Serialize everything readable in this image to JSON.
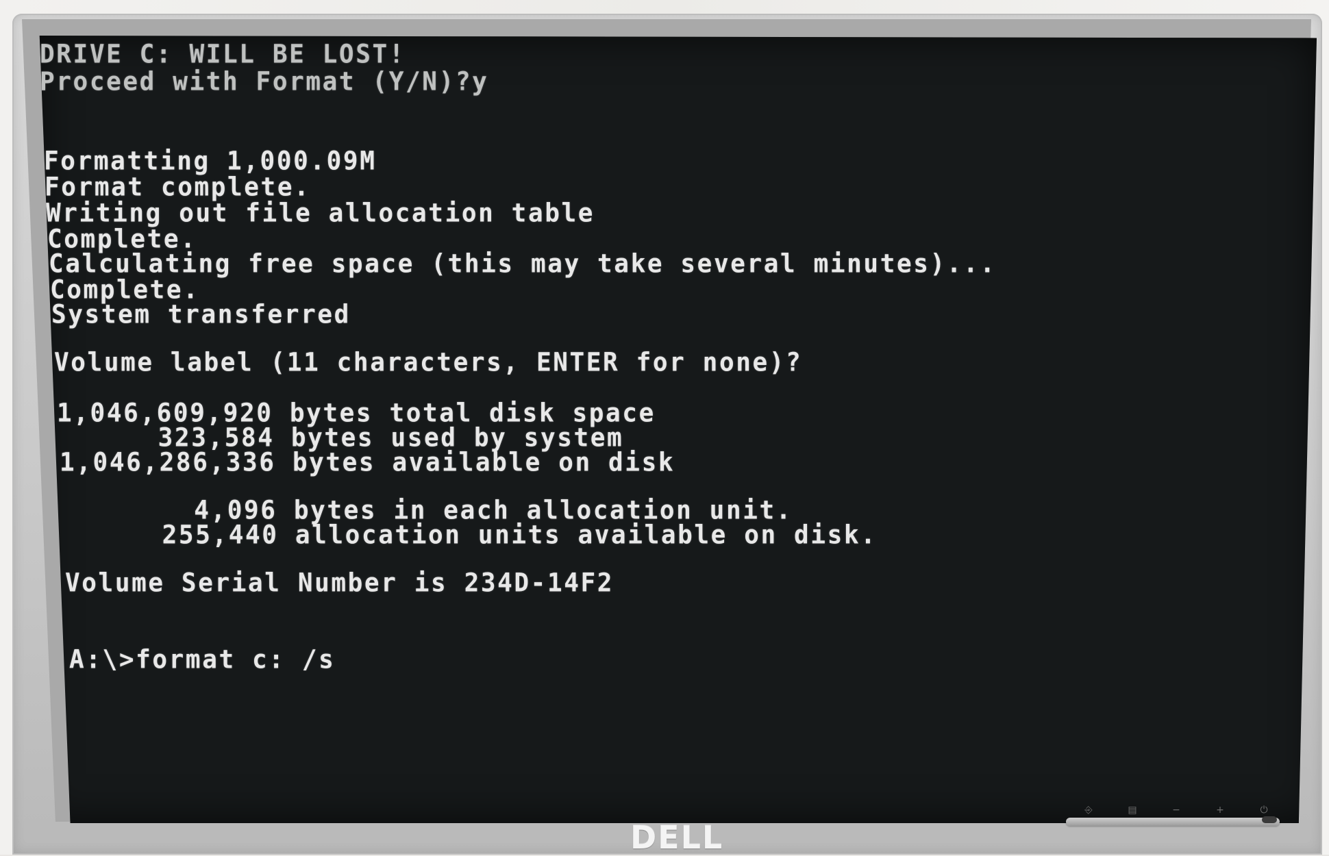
{
  "terminal": {
    "lines": {
      "warning": "DRIVE C: WILL BE LOST!",
      "proceed_prompt": "Proceed with Format (Y/N)?y",
      "formatting": "Formatting 1,000.09M",
      "format_complete": "Format complete.",
      "writing_fat": "Writing out file allocation table",
      "complete_1": "Complete.",
      "calculating": "Calculating free space (this may take several minutes)...",
      "complete_2": "Complete.",
      "system_transferred": "System transferred",
      "volume_label_prompt": "Volume label (11 characters, ENTER for none)?",
      "total_disk_space": "1,046,609,920 bytes total disk space",
      "used_by_system": "      323,584 bytes used by system",
      "available_on_disk": "1,046,286,336 bytes available on disk",
      "allocation_unit_size": "        4,096 bytes in each allocation unit.",
      "allocation_units_available": "      255,440 allocation units available on disk.",
      "serial_number": "Volume Serial Number is 234D-14F2",
      "command_prompt": "A:\\>format c: /s"
    }
  },
  "monitor": {
    "brand_logo": "DELL",
    "controls": [
      "input-source-icon",
      "menu-icon",
      "minus-icon",
      "plus-icon",
      "power-icon"
    ],
    "control_glyphs": {
      "input": "⎆",
      "menu": "▤",
      "minus": "−",
      "plus": "+",
      "power": "⏻"
    }
  },
  "colors": {
    "screen_background": "#16191a",
    "terminal_text": "#e8e8e8",
    "bezel": "#c9c9c9"
  }
}
